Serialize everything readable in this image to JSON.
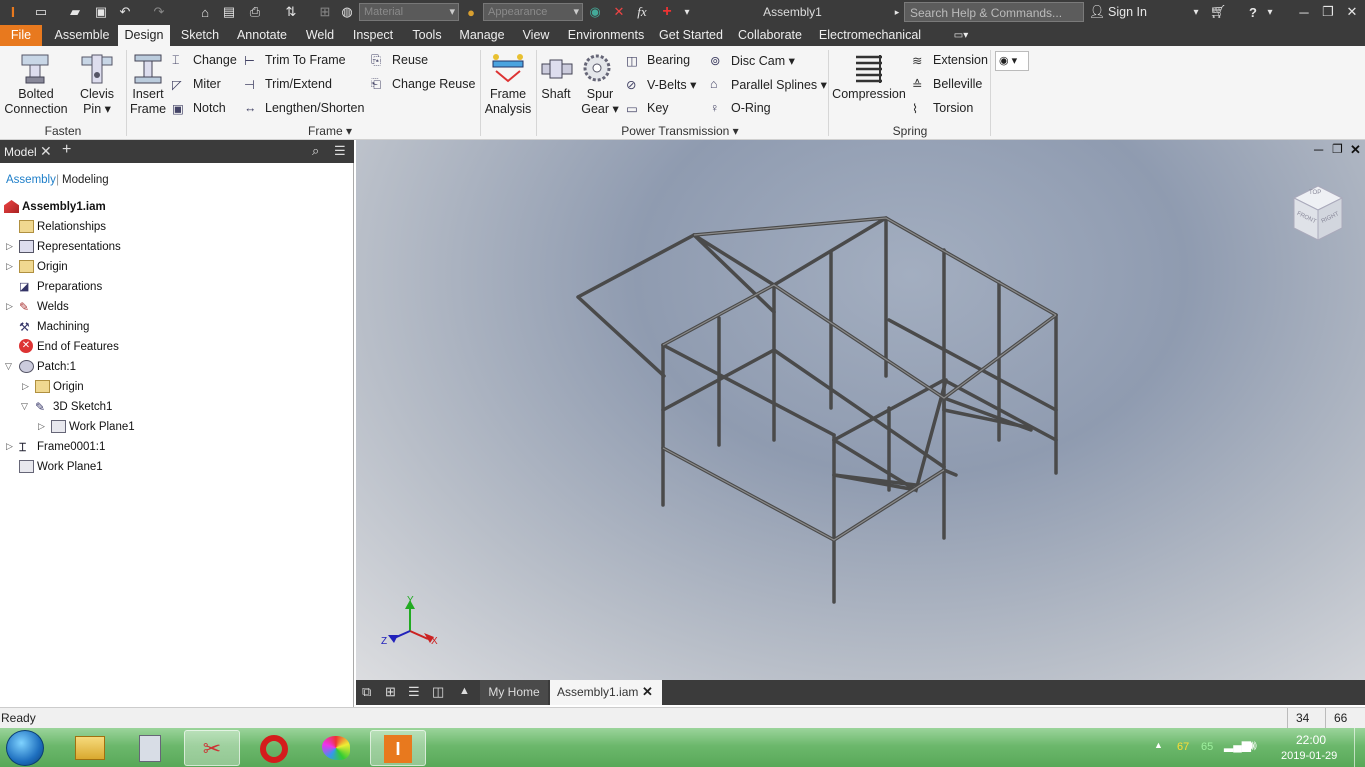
{
  "titlebar": {
    "material_placeholder": "Material",
    "appearance_placeholder": "Appearance",
    "fx_label": "fx",
    "title": "Assembly1",
    "search_placeholder": "Search Help & Commands...",
    "sign_in": "Sign In"
  },
  "menu": {
    "tabs": [
      "File",
      "Assemble",
      "Design",
      "Sketch",
      "Annotate",
      "Weld",
      "Inspect",
      "Tools",
      "Manage",
      "View",
      "Environments",
      "Get Started",
      "Collaborate",
      "Electromechanical"
    ],
    "active": "Design"
  },
  "ribbon": {
    "fasten": {
      "title": "Fasten",
      "bolted_1": "Bolted",
      "bolted_2": "Connection",
      "clevis_1": "Clevis",
      "clevis_2": "Pin"
    },
    "frame": {
      "title": "Frame",
      "insert_1": "Insert",
      "insert_2": "Frame",
      "change": "Change",
      "miter": "Miter",
      "notch": "Notch",
      "trim_to_frame": "Trim To Frame",
      "trim_extend": "Trim/Extend",
      "lengthen": "Lengthen/Shorten",
      "reuse": "Reuse",
      "change_reuse": "Change Reuse"
    },
    "analysis": {
      "frame_1": "Frame",
      "frame_2": "Analysis"
    },
    "power": {
      "title": "Power Transmission",
      "shaft": "Shaft",
      "spur_1": "Spur",
      "spur_2": "Gear",
      "bearing": "Bearing",
      "vbelts": "V-Belts",
      "key": "Key",
      "disc_cam": "Disc Cam",
      "parallel_splines": "Parallel Splines",
      "oring": "O-Ring"
    },
    "spring": {
      "title": "Spring",
      "compression": "Compression",
      "extension": "Extension",
      "belleville": "Belleville",
      "torsion": "Torsion"
    }
  },
  "browser": {
    "tab": "Model",
    "mode_assembly": "Assembly",
    "mode_modeling": "Modeling",
    "root": "Assembly1.iam",
    "items": [
      "Relationships",
      "Representations",
      "Origin",
      "Preparations",
      "Welds",
      "Machining",
      "End of Features",
      "Patch:1",
      "Origin",
      "3D Sketch1",
      "Work Plane1",
      "Frame0001:1",
      "Work Plane1"
    ]
  },
  "viewcube": {
    "left": "FRONT",
    "right": "RIGHT",
    "top": "TOP"
  },
  "triad": {
    "x": "X",
    "y": "Y",
    "z": "Z"
  },
  "doctabs": {
    "home": "My Home",
    "doc": "Assembly1.iam"
  },
  "status": {
    "text": "Ready",
    "num1": "34",
    "num2": "66"
  },
  "taskbar": {
    "temp1": "67",
    "temp2": "65",
    "time": "22:00",
    "date": "2019-01-29"
  }
}
